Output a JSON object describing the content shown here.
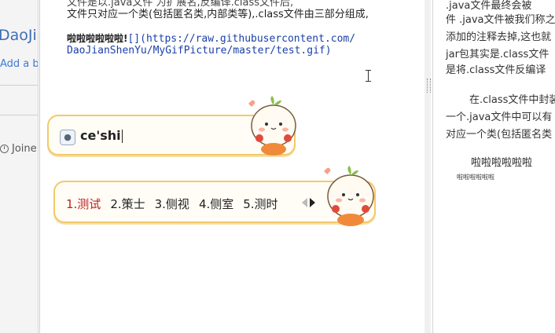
{
  "background_window": {
    "brand_text": "DaoJia",
    "add_text": "Add a b",
    "joined_text": "Joine"
  },
  "editor": {
    "cut_line": "文件是以.java文件 为扩展名,反编译.class文件后,",
    "line1": "文件只对应一个类(包括匿名类,内部类等),.class文件由三部分组成,",
    "md_text": "啦啦啦啦啦啦!",
    "md_link_part1": "[](https://raw.githubusercontent.com/",
    "md_link_part2": "DaoJianShenYu/MyGifPicture/master/test.gif)"
  },
  "preview": {
    "p1": ".java文件最终会被",
    "p2": "件 .java文件被我们称之",
    "p3": "添加的注释去掉,这也就",
    "p4": "jar包其实是.class文件",
    "p5": "是将.class文件反编译",
    "p6": "在.class文件中封装",
    "p7": "一个.java文件中可以有",
    "p8": "对应一个类(包括匿名类",
    "p9": "啦啦啦啦啦啦",
    "p10": "啦啦啦啦啦啦"
  },
  "ime": {
    "composition": "ce'shi",
    "bulb_icon": "lightbulb-icon",
    "candidates": [
      "1.测试",
      "2.策士",
      "3.侧视",
      "4.侧室",
      "5.测时"
    ],
    "selected_index": 0
  },
  "colors": {
    "ime_border": "#f2c96a",
    "selected_candidate": "#b22222",
    "link": "#1a3fa8"
  }
}
